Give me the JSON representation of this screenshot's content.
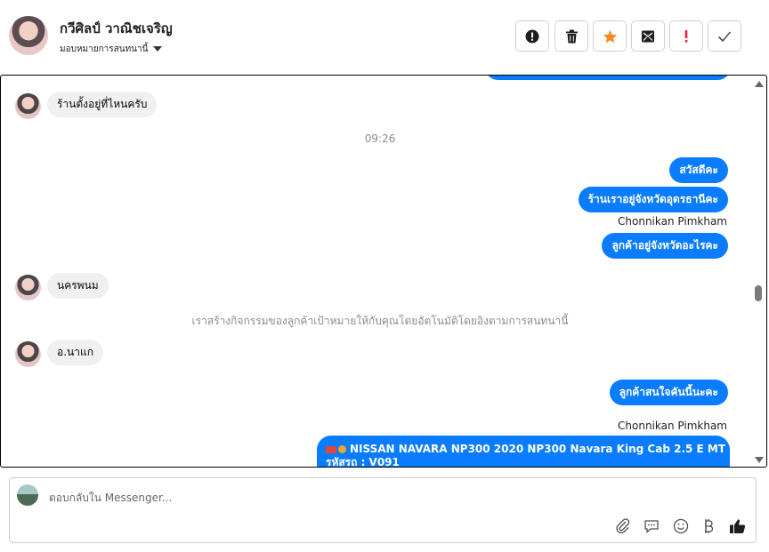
{
  "header": {
    "name": "กวีศิลป์ วาณิชเจริญ",
    "assign_label": "มอบหมายการสนทนานี้",
    "actions": [
      {
        "icon": "alert-circle-icon",
        "name": "mark-spam-button"
      },
      {
        "icon": "trash-icon",
        "name": "delete-button"
      },
      {
        "icon": "star-icon",
        "name": "star-button"
      },
      {
        "icon": "mark-unread-icon",
        "name": "mark-unread-button"
      },
      {
        "icon": "exclamation-icon",
        "name": "mark-important-button"
      },
      {
        "icon": "check-icon",
        "name": "mark-done-button"
      }
    ]
  },
  "colors": {
    "outgoing_bubble": "#0a7cff",
    "incoming_bubble": "#f0f0f0",
    "star": "#f28b1e",
    "important": "#e41e3f"
  },
  "messages": {
    "m1": "ร้านตั้งอยู่ที่ไหนครับ",
    "time1": "09:26",
    "m2": "สวัสดีคะ",
    "m3": "ร้านเราอยู่จังหวัดอุดรธานีคะ",
    "sender1": "Chonnikan Pimkham",
    "m4": "ลูกค้าอยู่จังหวัดอะไรคะ",
    "m5": "นครพนม",
    "system1": "เราสร้างกิจกรรมของลูกค้าเป้าหมายให้กับคุณโดยอัตโนมัติโดยอิงตามการสนทนานี้",
    "m6": "อ.นาแก",
    "m7": "ลูกค้าสนใจคันนี้นะคะ",
    "sender2": "Chonnikan Pimkham",
    "m8_line1": "NISSAN NAVARA NP300 2020 NP300 Navara King Cab 2.5 E MT",
    "m8_line2": "รหัสรถ : V091"
  },
  "composer": {
    "placeholder": "ตอบกลับใน Messenger...",
    "tools": [
      "paperclip-icon",
      "quick-reply-icon",
      "emoji-icon",
      "baht-icon",
      "thumbs-up-icon"
    ]
  }
}
